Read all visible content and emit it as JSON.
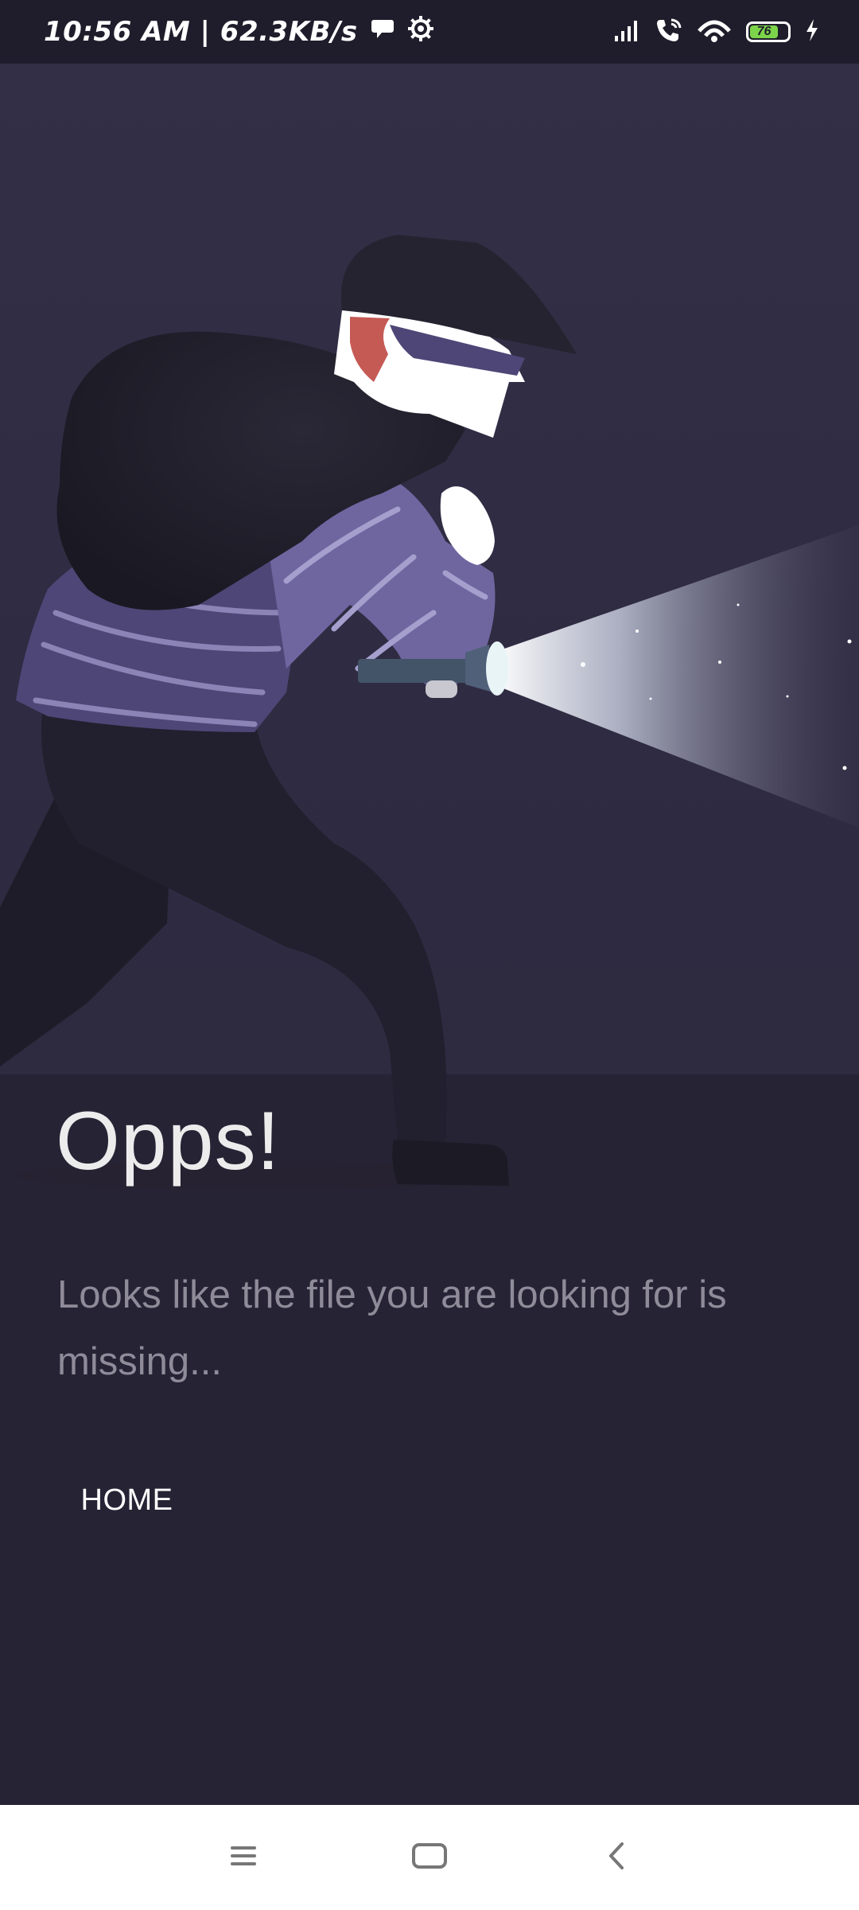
{
  "status_bar": {
    "time_speed": "10:56 AM | 62.3KB/s",
    "battery_level": "76",
    "icons": [
      "chat-bubble-icon",
      "gear-icon",
      "signal-icon",
      "wifi-calling-icon",
      "hotspot-icon",
      "battery-icon",
      "charging-icon"
    ]
  },
  "page": {
    "title": "Opps!",
    "message": "Looks like the file you are looking for is missing...",
    "home_label": "HOME"
  },
  "nav_bar": {
    "icons": [
      "menu-icon",
      "home-square-icon",
      "back-icon"
    ]
  },
  "colors": {
    "background": "#262335",
    "illustration_background": "#332f47",
    "sweater": "#4e4676",
    "stripe": "#8c84b6",
    "title_text": "#ececec",
    "message_text": "#8f8b99",
    "button_text": "#ffffff"
  }
}
